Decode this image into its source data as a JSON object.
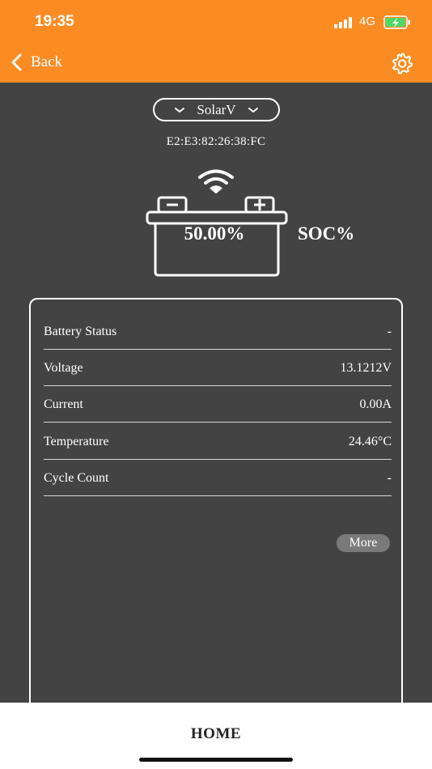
{
  "status_bar": {
    "time": "19:35",
    "network": "4G"
  },
  "header": {
    "back_label": "Back"
  },
  "device": {
    "name": "SolarV",
    "mac": "E2:E3:82:26:38:FC"
  },
  "battery": {
    "soc_value": "50.00%",
    "soc_label": "SOC%"
  },
  "details": {
    "rows": [
      {
        "label": "Battery Status",
        "value": "-"
      },
      {
        "label": "Voltage",
        "value": "13.1212V"
      },
      {
        "label": "Current",
        "value": "0.00A"
      },
      {
        "label": "Temperature",
        "value": "24.46°C"
      },
      {
        "label": "Cycle Count",
        "value": "-"
      }
    ],
    "more_label": "More"
  },
  "tabbar": {
    "home_label": "HOME"
  },
  "colors": {
    "accent": "#FB8C24",
    "background": "#434343",
    "charging": "#4CD964"
  }
}
